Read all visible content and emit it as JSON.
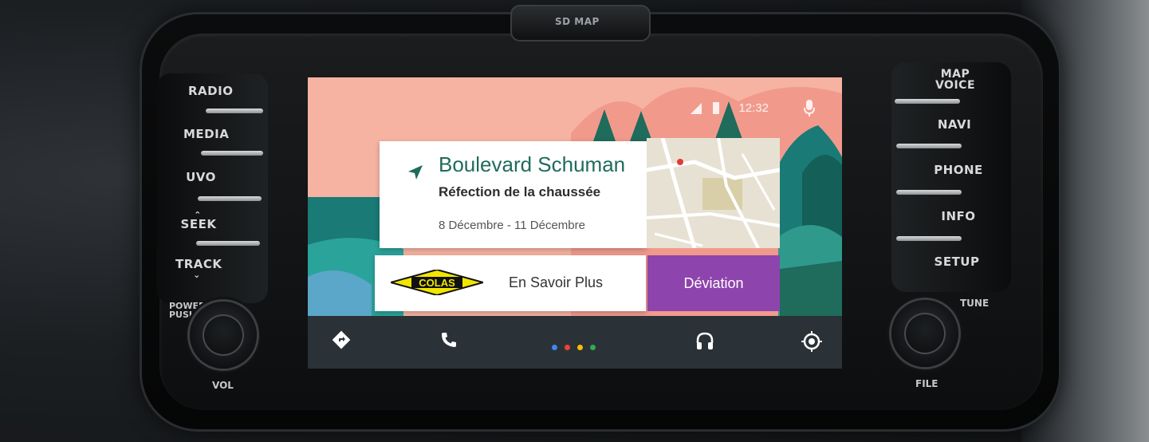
{
  "hardware": {
    "sd_label": "SD MAP",
    "left_buttons": [
      "RADIO",
      "MEDIA",
      "UVO",
      "SEEK",
      "TRACK"
    ],
    "right_buttons": [
      "MAP VOICE",
      "NAVI",
      "PHONE",
      "INFO",
      "SETUP"
    ],
    "power_label": "POWER PUSH",
    "vol_label": "VOL",
    "tune_label": "TUNE",
    "file_label": "FILE"
  },
  "status_bar": {
    "time": "12:32"
  },
  "notification": {
    "street": "Boulevard Schuman",
    "subtitle": "Réfection de la chaussée",
    "dates": "8 Décembre - 11 Décembre",
    "logo_text": "COLAS",
    "more_label": "En Savoir Plus",
    "detour_label": "Déviation",
    "accent_color": "#1f6b5c",
    "detour_color": "#8e44ad"
  },
  "appbar": {
    "icons": [
      "navigation-icon",
      "phone-icon",
      "headphones-icon",
      "home-icon"
    ],
    "page_dots": [
      "#4285f4",
      "#ea4335",
      "#fbbc05",
      "#34a853"
    ]
  }
}
